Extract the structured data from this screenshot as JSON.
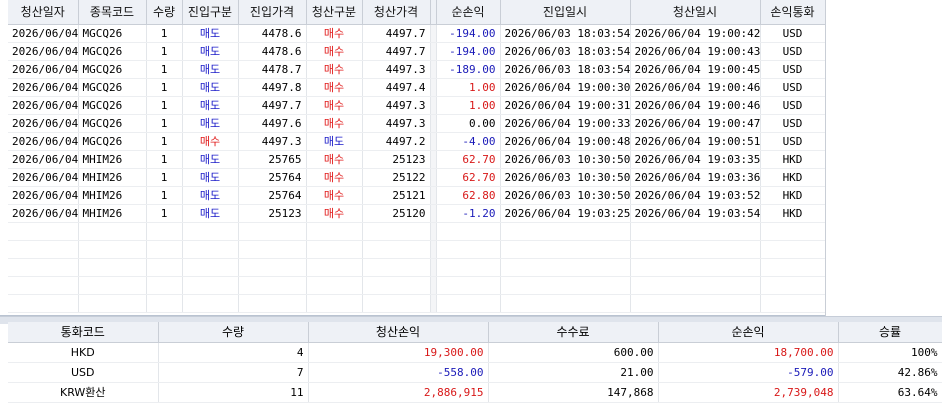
{
  "trades": {
    "headers": [
      "청산일자",
      "종목코드",
      "수량",
      "진입구분",
      "진입가격",
      "청산구분",
      "청산가격",
      "순손익",
      "진입일시",
      "청산일시",
      "손익통화"
    ],
    "rows": [
      {
        "close_date": "2026/06/04",
        "code": "MGCQ26",
        "qty": "1",
        "entry_side": "매도",
        "entry_price": "4478.6",
        "close_side": "매수",
        "close_price": "4497.7",
        "pnl": "-194.00",
        "pnl_sign": "neg",
        "entry_time": "2026/06/03 18:03:54",
        "close_time": "2026/06/04 19:00:42",
        "currency": "USD"
      },
      {
        "close_date": "2026/06/04",
        "code": "MGCQ26",
        "qty": "1",
        "entry_side": "매도",
        "entry_price": "4478.6",
        "close_side": "매수",
        "close_price": "4497.7",
        "pnl": "-194.00",
        "pnl_sign": "neg",
        "entry_time": "2026/06/03 18:03:54",
        "close_time": "2026/06/04 19:00:43",
        "currency": "USD"
      },
      {
        "close_date": "2026/06/04",
        "code": "MGCQ26",
        "qty": "1",
        "entry_side": "매도",
        "entry_price": "4478.7",
        "close_side": "매수",
        "close_price": "4497.3",
        "pnl": "-189.00",
        "pnl_sign": "neg",
        "entry_time": "2026/06/03 18:03:54",
        "close_time": "2026/06/04 19:00:45",
        "currency": "USD"
      },
      {
        "close_date": "2026/06/04",
        "code": "MGCQ26",
        "qty": "1",
        "entry_side": "매도",
        "entry_price": "4497.8",
        "close_side": "매수",
        "close_price": "4497.4",
        "pnl": "1.00",
        "pnl_sign": "pos",
        "entry_time": "2026/06/04 19:00:30",
        "close_time": "2026/06/04 19:00:46",
        "currency": "USD"
      },
      {
        "close_date": "2026/06/04",
        "code": "MGCQ26",
        "qty": "1",
        "entry_side": "매도",
        "entry_price": "4497.7",
        "close_side": "매수",
        "close_price": "4497.3",
        "pnl": "1.00",
        "pnl_sign": "pos",
        "entry_time": "2026/06/04 19:00:31",
        "close_time": "2026/06/04 19:00:46",
        "currency": "USD"
      },
      {
        "close_date": "2026/06/04",
        "code": "MGCQ26",
        "qty": "1",
        "entry_side": "매도",
        "entry_price": "4497.6",
        "close_side": "매수",
        "close_price": "4497.3",
        "pnl": "0.00",
        "pnl_sign": "zero",
        "entry_time": "2026/06/04 19:00:33",
        "close_time": "2026/06/04 19:00:47",
        "currency": "USD"
      },
      {
        "close_date": "2026/06/04",
        "code": "MGCQ26",
        "qty": "1",
        "entry_side": "매수",
        "entry_price": "4497.3",
        "close_side": "매도",
        "close_price": "4497.2",
        "pnl": "-4.00",
        "pnl_sign": "neg",
        "entry_time": "2026/06/04 19:00:48",
        "close_time": "2026/06/04 19:00:51",
        "currency": "USD"
      },
      {
        "close_date": "2026/06/04",
        "code": "MHIM26",
        "qty": "1",
        "entry_side": "매도",
        "entry_price": "25765",
        "close_side": "매수",
        "close_price": "25123",
        "pnl": "62.70",
        "pnl_sign": "pos",
        "entry_time": "2026/06/03 10:30:50",
        "close_time": "2026/06/04 19:03:35",
        "currency": "HKD"
      },
      {
        "close_date": "2026/06/04",
        "code": "MHIM26",
        "qty": "1",
        "entry_side": "매도",
        "entry_price": "25764",
        "close_side": "매수",
        "close_price": "25122",
        "pnl": "62.70",
        "pnl_sign": "pos",
        "entry_time": "2026/06/03 10:30:50",
        "close_time": "2026/06/04 19:03:36",
        "currency": "HKD"
      },
      {
        "close_date": "2026/06/04",
        "code": "MHIM26",
        "qty": "1",
        "entry_side": "매도",
        "entry_price": "25764",
        "close_side": "매수",
        "close_price": "25121",
        "pnl": "62.80",
        "pnl_sign": "pos",
        "entry_time": "2026/06/03 10:30:50",
        "close_time": "2026/06/04 19:03:52",
        "currency": "HKD"
      },
      {
        "close_date": "2026/06/04",
        "code": "MHIM26",
        "qty": "1",
        "entry_side": "매도",
        "entry_price": "25123",
        "close_side": "매수",
        "close_price": "25120",
        "pnl": "-1.20",
        "pnl_sign": "neg",
        "entry_time": "2026/06/04 19:03:25",
        "close_time": "2026/06/04 19:03:54",
        "currency": "HKD"
      }
    ]
  },
  "summary": {
    "headers": [
      "통화코드",
      "수량",
      "청산손익",
      "수수료",
      "순손익",
      "승률"
    ],
    "rows": [
      {
        "currency": "HKD",
        "qty": "4",
        "close_pnl": "19,300.00",
        "close_pnl_sign": "pos",
        "fee": "600.00",
        "net_pnl": "18,700.00",
        "net_pnl_sign": "pos",
        "win_rate": "100%"
      },
      {
        "currency": "USD",
        "qty": "7",
        "close_pnl": "-558.00",
        "close_pnl_sign": "neg",
        "fee": "21.00",
        "net_pnl": "-579.00",
        "net_pnl_sign": "neg",
        "win_rate": "42.86%"
      },
      {
        "currency": "KRW환산",
        "qty": "11",
        "close_pnl": "2,886,915",
        "close_pnl_sign": "pos",
        "fee": "147,868",
        "net_pnl": "2,739,048",
        "net_pnl_sign": "pos",
        "win_rate": "63.64%"
      }
    ]
  },
  "colors": {
    "buy": "#e01818",
    "sell": "#1a1ac8",
    "header_bg": "#eef1f6"
  }
}
